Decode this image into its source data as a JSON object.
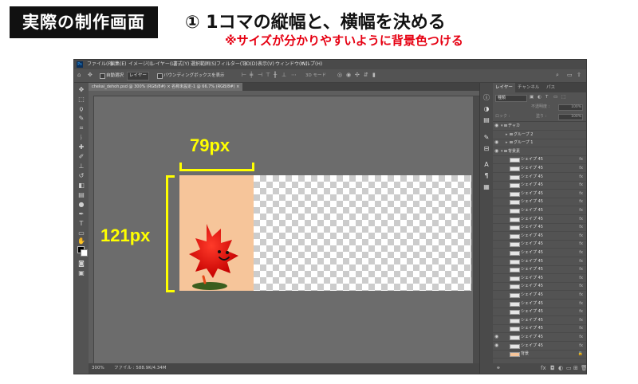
{
  "header": {
    "badge": "実際の制作画面",
    "step_title": "① 1コマの縦幅と、横幅を決める",
    "step_sub": "※サイズが分かりやすいように背景色つける"
  },
  "annotations": {
    "width_label": "79px",
    "height_label": "121px",
    "color": "#ffff00"
  },
  "app": {
    "logo": "Ps",
    "menu": [
      "ファイル(F)",
      "編集(E)",
      "イメージ(I)",
      "レイヤー(L)",
      "書式(Y)",
      "選択範囲(S)",
      "フィルター(T)",
      "3D(D)",
      "表示(V)",
      "ウィンドウ(W)",
      "ヘルプ(H)"
    ],
    "options": {
      "auto_select": "自動選択",
      "target": "レイヤー",
      "show_transform": "バウンディングボックスを表示",
      "mode_3d": "3D モード"
    },
    "doc_tab": "chekai_dehoh.psd @ 300% (RGB/8#) ×   名称未設定-1 @ 66.7% (RGB/8#) ×",
    "status": {
      "zoom": "300%",
      "file_info": "ファイル : 588.9K/4.34M"
    },
    "frame_bg_color": "#f6c59a"
  },
  "layers_panel": {
    "tabs": [
      "レイヤー",
      "チャンネル",
      "パス"
    ],
    "kind": "種類",
    "opacity_label": "不透明度 :",
    "opacity_value": "100%",
    "fill_label": "塗り :",
    "fill_value": "100%",
    "lock_label": "ロック :",
    "layers": [
      {
        "name": "ヂャカ",
        "type": "group",
        "eye": true
      },
      {
        "name": "グループ 2",
        "type": "subgroup",
        "eye": false
      },
      {
        "name": "グループ 1",
        "type": "subgroup",
        "eye": true
      },
      {
        "name": "背景素",
        "type": "group",
        "eye": true
      },
      {
        "name": "シェイプ 45",
        "fx": "fx",
        "eye": false
      },
      {
        "name": "シェイプ 45",
        "fx": "fx",
        "eye": false
      },
      {
        "name": "シェイプ 45",
        "fx": "fx",
        "eye": false
      },
      {
        "name": "シェイプ 45",
        "fx": "fx",
        "eye": false
      },
      {
        "name": "シェイプ 45",
        "fx": "fx",
        "eye": false
      },
      {
        "name": "シェイプ 45",
        "fx": "fx",
        "eye": false
      },
      {
        "name": "シェイプ 45",
        "fx": "fx",
        "eye": false
      },
      {
        "name": "シェイプ 45",
        "fx": "fx",
        "eye": false
      },
      {
        "name": "シェイプ 45",
        "fx": "fx",
        "eye": false
      },
      {
        "name": "シェイプ 45",
        "fx": "fx",
        "eye": false
      },
      {
        "name": "シェイプ 45",
        "fx": "fx",
        "eye": false
      },
      {
        "name": "シェイプ 45",
        "fx": "fx",
        "eye": false
      },
      {
        "name": "シェイプ 45",
        "fx": "fx",
        "eye": false
      },
      {
        "name": "シェイプ 45",
        "fx": "fx",
        "eye": false
      },
      {
        "name": "シェイプ 45",
        "fx": "fx",
        "eye": false
      },
      {
        "name": "シェイプ 45",
        "fx": "fx",
        "eye": false
      },
      {
        "name": "シェイプ 45",
        "fx": "fx",
        "eye": false
      },
      {
        "name": "シェイプ 45",
        "fx": "fx",
        "eye": false
      },
      {
        "name": "シェイプ 45",
        "fx": "fx",
        "eye": false
      },
      {
        "name": "シェイプ 45",
        "fx": "fx",
        "eye": false
      },
      {
        "name": "シェイプ 45",
        "fx": "fx",
        "eye": false
      },
      {
        "name": "シェイプ 45",
        "fx": "fx",
        "eye": true
      },
      {
        "name": "シェイプ 45",
        "fx": "fx",
        "eye": true
      },
      {
        "name": "背景",
        "type": "background",
        "eye": false,
        "locked": true
      }
    ]
  }
}
